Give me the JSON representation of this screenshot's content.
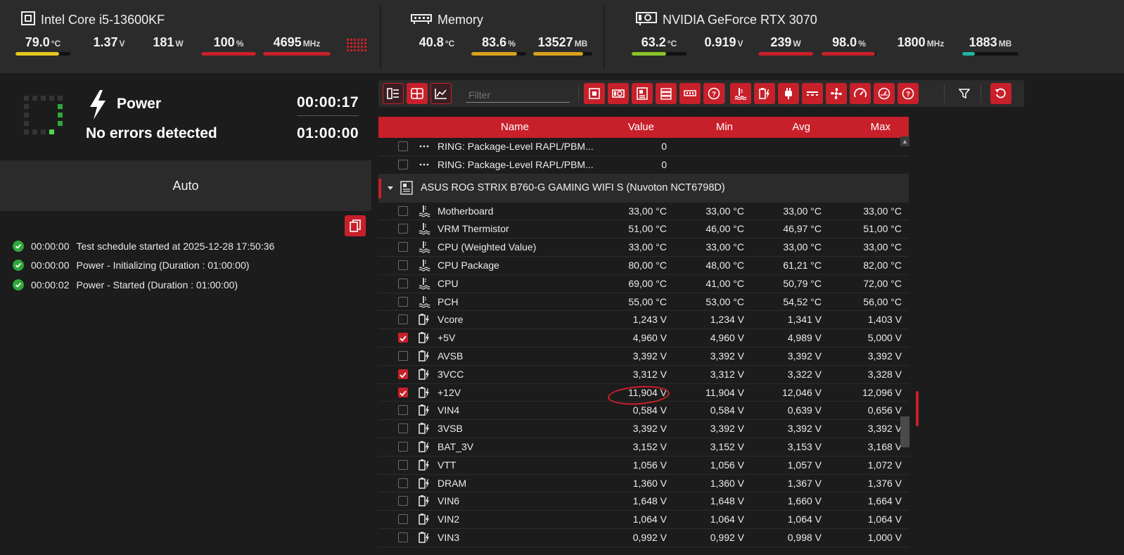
{
  "colors": {
    "accent": "#c8202a",
    "ok": "#2fa83a",
    "bar_yellow": "#e6c81e",
    "bar_red": "#c8202a",
    "bar_orange": "#d9a11c",
    "bar_green": "#8bc52a",
    "bar_teal": "#20b5a2"
  },
  "header": {
    "cpu": {
      "icon": "cpu-icon",
      "name": "Intel Core i5-13600KF",
      "metrics": [
        {
          "value": "79.0",
          "unit": "°C",
          "bar": 0.79,
          "color": "#e6c81e"
        },
        {
          "value": "1.37",
          "unit": "V"
        },
        {
          "value": "181",
          "unit": "W"
        },
        {
          "value": "100",
          "unit": "%",
          "bar": 1.0,
          "color": "#c8202a"
        },
        {
          "value": "4695",
          "unit": "MHz",
          "bar": 1.0,
          "color": "#c8202a"
        }
      ]
    },
    "memory": {
      "icon": "memory-icon",
      "name": "Memory",
      "metrics": [
        {
          "value": "40.8",
          "unit": "°C"
        },
        {
          "value": "83.6",
          "unit": "%",
          "bar": 0.836,
          "color": "#d9a11c"
        },
        {
          "value": "13527",
          "unit": "MB",
          "bar": 0.84,
          "color": "#d9a11c"
        }
      ]
    },
    "gpu": {
      "icon": "gpu-icon",
      "name": "NVIDIA GeForce RTX 3070",
      "metrics": [
        {
          "value": "63.2",
          "unit": "°C",
          "bar": 0.63,
          "color": "#8bc52a"
        },
        {
          "value": "0.919",
          "unit": "V"
        },
        {
          "value": "239",
          "unit": "W",
          "bar": 1.0,
          "color": "#c8202a"
        },
        {
          "value": "98.0",
          "unit": "%",
          "bar": 0.98,
          "color": "#c8202a"
        },
        {
          "value": "1800",
          "unit": "MHz"
        },
        {
          "value": "1883",
          "unit": "MB",
          "bar": 0.23,
          "color": "#20b5a2"
        }
      ]
    }
  },
  "test": {
    "name": "Power",
    "status": "No errors detected",
    "elapsed": "00:00:17",
    "duration": "01:00:00",
    "mode": "Auto"
  },
  "log": [
    {
      "time": "00:00:00",
      "text": "Test schedule started at 2025-12-28 17:50:36"
    },
    {
      "time": "00:00:00",
      "text": "Power - Initializing (Duration : 01:00:00)"
    },
    {
      "time": "00:00:02",
      "text": "Power - Started (Duration : 01:00:00)"
    }
  ],
  "toolbar": {
    "filter_placeholder": "Filter",
    "view_buttons": [
      "list-view-icon",
      "grid-view-icon",
      "chart-view-icon"
    ],
    "hw_buttons": [
      "cpu-filter-icon",
      "gpu-filter-icon",
      "motherboard-filter-icon",
      "storage-filter-icon",
      "memory-filter-icon",
      "help-icon"
    ],
    "sensor_buttons": [
      "temperature-filter-icon",
      "voltage-filter-icon",
      "power-filter-icon",
      "current-filter-icon",
      "fan-filter-icon",
      "clock-filter-icon",
      "usage-filter-icon",
      "help-icon"
    ]
  },
  "table": {
    "headers": {
      "name": "Name",
      "value": "Value",
      "min": "Min",
      "avg": "Avg",
      "max": "Max"
    },
    "pre_rows": [
      {
        "name": "RING: Package-Level RAPL/PBM...",
        "value": "0"
      },
      {
        "name": "RING: Package-Level RAPL/PBM...",
        "value": "0"
      }
    ],
    "group": "ASUS ROG STRIX B760-G GAMING WIFI S (Nuvoton NCT6798D)",
    "rows": [
      {
        "type": "temp",
        "checked": false,
        "name": "Motherboard",
        "value": "33,00 °C",
        "min": "33,00 °C",
        "avg": "33,00 °C",
        "max": "33,00 °C"
      },
      {
        "type": "temp",
        "checked": false,
        "name": "VRM Thermistor",
        "value": "51,00 °C",
        "min": "46,00 °C",
        "avg": "46,97 °C",
        "max": "51,00 °C"
      },
      {
        "type": "temp",
        "checked": false,
        "name": "CPU (Weighted Value)",
        "value": "33,00 °C",
        "min": "33,00 °C",
        "avg": "33,00 °C",
        "max": "33,00 °C"
      },
      {
        "type": "temp",
        "checked": false,
        "name": "CPU Package",
        "value": "80,00 °C",
        "min": "48,00 °C",
        "avg": "61,21 °C",
        "max": "82,00 °C"
      },
      {
        "type": "temp",
        "checked": false,
        "name": "CPU",
        "value": "69,00 °C",
        "min": "41,00 °C",
        "avg": "50,79 °C",
        "max": "72,00 °C"
      },
      {
        "type": "temp",
        "checked": false,
        "name": "PCH",
        "value": "55,00 °C",
        "min": "53,00 °C",
        "avg": "54,52 °C",
        "max": "56,00 °C"
      },
      {
        "type": "volt",
        "checked": false,
        "name": "Vcore",
        "value": "1,243 V",
        "min": "1,234 V",
        "avg": "1,341 V",
        "max": "1,403 V"
      },
      {
        "type": "volt",
        "checked": true,
        "name": "+5V",
        "value": "4,960 V",
        "min": "4,960 V",
        "avg": "4,989 V",
        "max": "5,000 V"
      },
      {
        "type": "volt",
        "checked": false,
        "name": "AVSB",
        "value": "3,392 V",
        "min": "3,392 V",
        "avg": "3,392 V",
        "max": "3,392 V"
      },
      {
        "type": "volt",
        "checked": true,
        "name": "3VCC",
        "value": "3,312 V",
        "min": "3,312 V",
        "avg": "3,322 V",
        "max": "3,328 V"
      },
      {
        "type": "volt",
        "checked": true,
        "name": "+12V",
        "value": "11,904 V",
        "min": "11,904 V",
        "avg": "12,046 V",
        "max": "12,096 V"
      },
      {
        "type": "volt",
        "checked": false,
        "name": "VIN4",
        "value": "0,584 V",
        "min": "0,584 V",
        "avg": "0,639 V",
        "max": "0,656 V"
      },
      {
        "type": "volt",
        "checked": false,
        "name": "3VSB",
        "value": "3,392 V",
        "min": "3,392 V",
        "avg": "3,392 V",
        "max": "3,392 V"
      },
      {
        "type": "volt",
        "checked": false,
        "name": "BAT_3V",
        "value": "3,152 V",
        "min": "3,152 V",
        "avg": "3,153 V",
        "max": "3,168 V"
      },
      {
        "type": "volt",
        "checked": false,
        "name": "VTT",
        "value": "1,056 V",
        "min": "1,056 V",
        "avg": "1,057 V",
        "max": "1,072 V"
      },
      {
        "type": "volt",
        "checked": false,
        "name": "DRAM",
        "value": "1,360 V",
        "min": "1,360 V",
        "avg": "1,367 V",
        "max": "1,376 V"
      },
      {
        "type": "volt",
        "checked": false,
        "name": "VIN6",
        "value": "1,648 V",
        "min": "1,648 V",
        "avg": "1,660 V",
        "max": "1,664 V"
      },
      {
        "type": "volt",
        "checked": false,
        "name": "VIN2",
        "value": "1,064 V",
        "min": "1,064 V",
        "avg": "1,064 V",
        "max": "1,064 V"
      },
      {
        "type": "volt",
        "checked": false,
        "name": "VIN3",
        "value": "0,992 V",
        "min": "0,992 V",
        "avg": "0,998 V",
        "max": "1,000 V"
      }
    ]
  }
}
